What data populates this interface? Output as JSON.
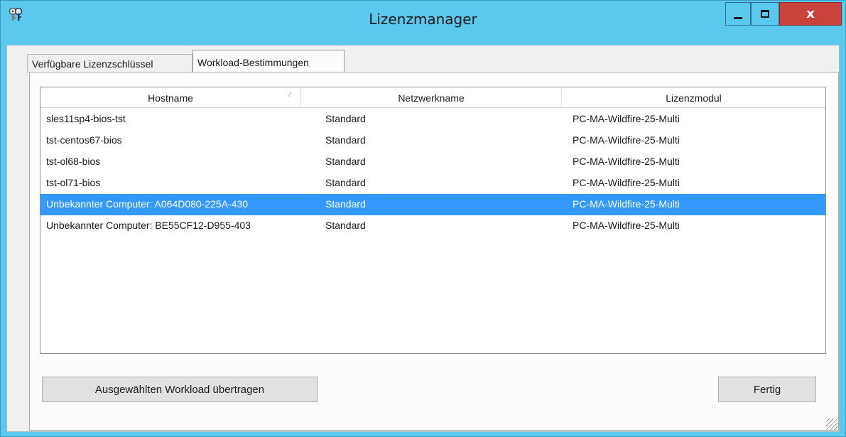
{
  "window": {
    "title": "Lizenzmanager",
    "icon": "app-key-icon",
    "controls": {
      "minimize": "minimize-icon",
      "maximize": "maximize-icon",
      "close_glyph": "x"
    }
  },
  "tabs": [
    {
      "label": "Verfügbare Lizenzschlüssel",
      "active": false
    },
    {
      "label": "Workload-Bestimmungen",
      "active": true
    }
  ],
  "table": {
    "columns": [
      "Hostname",
      "Netzwerkname",
      "Lizenzmodul"
    ],
    "sort_icon": "sort-icon",
    "rows": [
      [
        "sles11sp4-bios-tst",
        "Standard",
        "PC-MA-Wildfire-25-Multi"
      ],
      [
        "tst-centos67-bios",
        "Standard",
        "PC-MA-Wildfire-25-Multi"
      ],
      [
        "tst-ol68-bios",
        "Standard",
        "PC-MA-Wildfire-25-Multi"
      ],
      [
        "tst-ol71-bios",
        "Standard",
        "PC-MA-Wildfire-25-Multi"
      ],
      [
        "Unbekannter Computer: A064D080-225A-430",
        "Standard",
        "PC-MA-Wildfire-25-Multi"
      ],
      [
        "Unbekannter Computer: BE55CF12-D955-403",
        "Standard",
        "PC-MA-Wildfire-25-Multi"
      ]
    ],
    "selected_index": 4
  },
  "buttons": {
    "transfer": "Ausgewählten Workload übertragen",
    "done": "Fertig"
  },
  "colors": {
    "titlebar": "#5bc8ee",
    "close": "#c9423b",
    "selection": "#3399ff"
  }
}
